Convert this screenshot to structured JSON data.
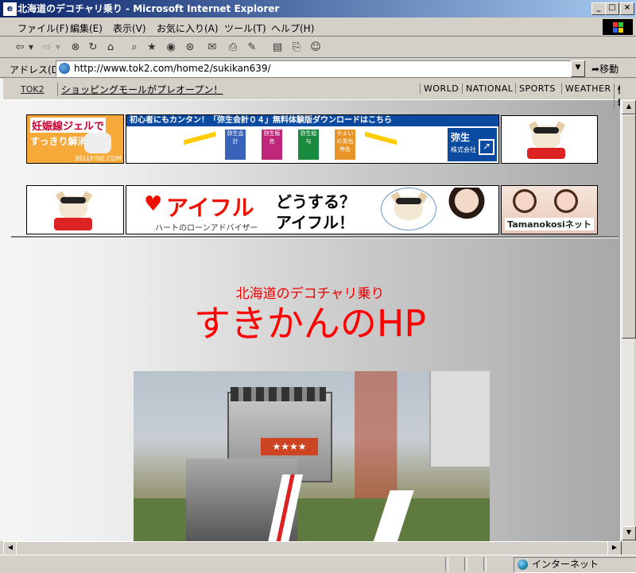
{
  "window": {
    "title": "北海道のデコチャリ乗り - Microsoft Internet Explorer",
    "minimize": "_",
    "maximize": "□",
    "close": "×"
  },
  "menu": [
    "ファイル(F)",
    "編集(E)",
    "表示(V)",
    "お気に入り(A)",
    "ツール(T)",
    "ヘルプ(H)"
  ],
  "address": {
    "label": "アドレス(D)",
    "url": "http://www.tok2.com/home2/sukikan639/",
    "go": "移動"
  },
  "tok2bar": {
    "link": "TOK2",
    "promo": "ショッピングモールがプレオープン！",
    "nav": [
      "WORLD",
      "NATIONAL",
      "SPORTS",
      "WEATHER",
      "情報"
    ]
  },
  "banners": {
    "bellfine": {
      "line1": "妊娠線ジェルで",
      "line2": "すっきり解消",
      "footer": "BELLFINE.COM"
    },
    "yayoi": {
      "headline": "初心者にもカンタン！「弥生会計０４」無料体験版ダウンロードはこちら",
      "logo_line1": "弥生",
      "logo_line2": "株式会社",
      "products": [
        "弥生会計",
        "弥生販売",
        "弥生給与",
        "やよいの青色申告"
      ]
    },
    "aiful": {
      "brand": "アイフル",
      "tagline": "ハートのローンアドバイザー",
      "copy_line1": "どうする？",
      "copy_line2": "アイフル！"
    },
    "tamanokosi": {
      "label": "Tamanokosiネット"
    }
  },
  "page": {
    "subtitle": "北海道のデコチャリ乗り",
    "title": "すきかんのHP"
  },
  "status": {
    "zone": "インターネット"
  },
  "colors": {
    "title_red": "#ff0000",
    "titlebar_start": "#0a246a",
    "titlebar_end": "#a6caf0",
    "chrome": "#d4d0c8"
  }
}
